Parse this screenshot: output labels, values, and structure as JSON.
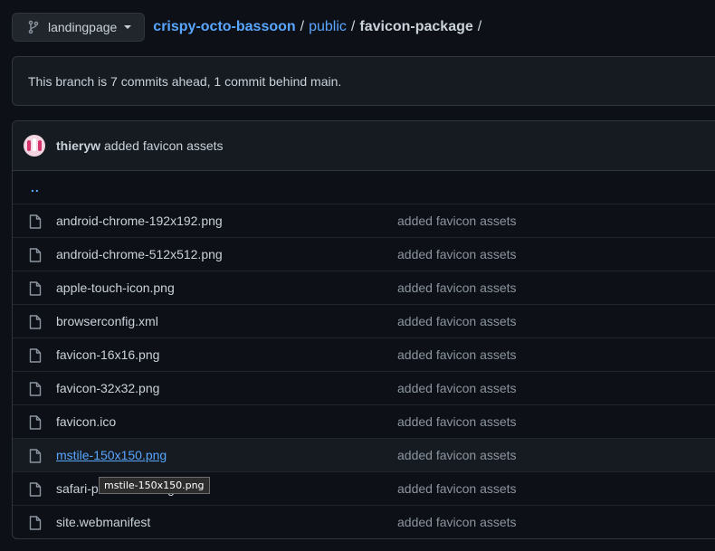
{
  "branch": {
    "name": "landingpage",
    "icon": "git-branch-icon"
  },
  "breadcrumb": {
    "repo": "crispy-octo-bassoon",
    "sep1": "/",
    "dir": "public",
    "sep2": "/",
    "current": "favicon-package",
    "sep3": "/"
  },
  "notice": {
    "text": "This branch is 7 commits ahead, 1 commit behind main."
  },
  "commit": {
    "author": "thieryw",
    "message": "added favicon assets"
  },
  "parent_dir": "..",
  "files": [
    {
      "name": "android-chrome-192x192.png",
      "message": "added favicon assets"
    },
    {
      "name": "android-chrome-512x512.png",
      "message": "added favicon assets"
    },
    {
      "name": "apple-touch-icon.png",
      "message": "added favicon assets"
    },
    {
      "name": "browserconfig.xml",
      "message": "added favicon assets"
    },
    {
      "name": "favicon-16x16.png",
      "message": "added favicon assets"
    },
    {
      "name": "favicon-32x32.png",
      "message": "added favicon assets"
    },
    {
      "name": "favicon.ico",
      "message": "added favicon assets"
    },
    {
      "name": "mstile-150x150.png",
      "message": "added favicon assets"
    },
    {
      "name": "safari-pinned-tab.svg",
      "message": "added favicon assets"
    },
    {
      "name": "site.webmanifest",
      "message": "added favicon assets"
    }
  ],
  "tooltip": {
    "text": "mstile-150x150.png"
  },
  "colors": {
    "background": "#0d1117",
    "link": "#58a6ff",
    "muted": "#8b949e",
    "border": "#30363d"
  }
}
